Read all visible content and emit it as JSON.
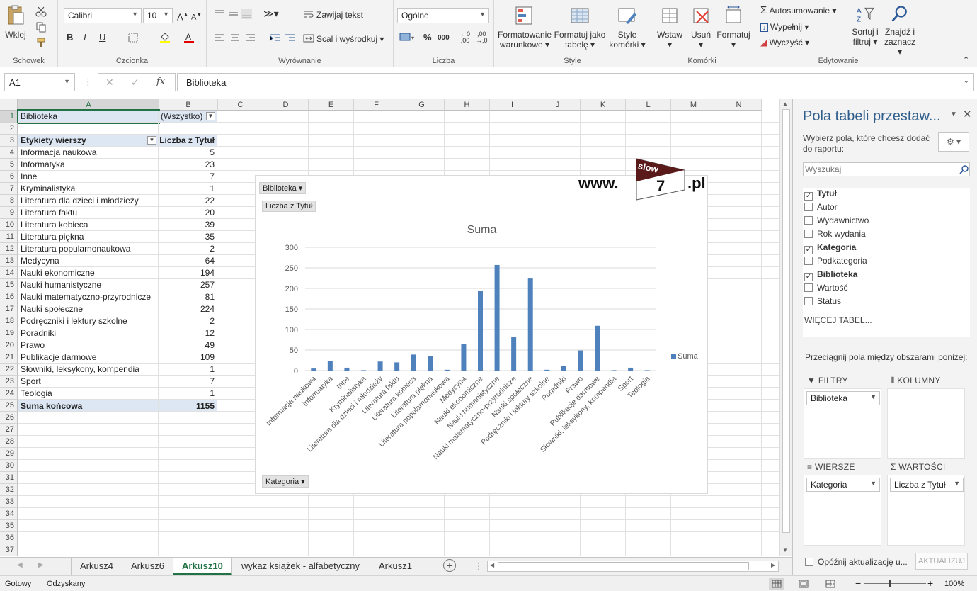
{
  "ribbon": {
    "clipboard": {
      "paste": "Wklej",
      "label": "Schowek"
    },
    "font": {
      "name": "Calibri",
      "size": "10",
      "bold": "B",
      "italic": "I",
      "underline": "U",
      "label": "Czcionka"
    },
    "alignment": {
      "wrap": "Zawijaj tekst",
      "merge": "Scal i wyśrodkuj",
      "label": "Wyrównanie"
    },
    "number": {
      "format": "Ogólne",
      "percent": "%",
      "thousands": "000",
      "label": "Liczba"
    },
    "styles": {
      "conditional": "Formatowanie warunkowe",
      "table": "Formatuj jako tabelę",
      "cell": "Style komórki",
      "label": "Style"
    },
    "cells": {
      "insert": "Wstaw",
      "delete": "Usuń",
      "format": "Formatuj",
      "label": "Komórki"
    },
    "editing": {
      "autosum": "Autosumowanie",
      "fill": "Wypełnij",
      "clear": "Wyczyść",
      "sort": "Sortuj i filtruj",
      "find": "Znajdź i zaznacz",
      "label": "Edytowanie"
    }
  },
  "formula_bar": {
    "cell_ref": "A1",
    "fx": "fx",
    "value": "Biblioteka"
  },
  "columns": [
    "A",
    "B",
    "C",
    "D",
    "E",
    "F",
    "G",
    "H",
    "I",
    "J",
    "K",
    "L",
    "M",
    "N"
  ],
  "pivot": {
    "filter_label": "Biblioteka",
    "filter_value": "(Wszystko)",
    "row_header": "Etykiety wierszy",
    "value_header": "Liczba z Tytuł",
    "rows": [
      {
        "label": "Informacja naukowa",
        "value": "5"
      },
      {
        "label": "Informatyka",
        "value": "23"
      },
      {
        "label": "Inne",
        "value": "7"
      },
      {
        "label": "Kryminalistyka",
        "value": "1"
      },
      {
        "label": "Literatura dla dzieci i młodzieży",
        "value": "22"
      },
      {
        "label": "Literatura faktu",
        "value": "20"
      },
      {
        "label": "Literatura kobieca",
        "value": "39"
      },
      {
        "label": "Literatura piękna",
        "value": "35"
      },
      {
        "label": "Literatura popularnonaukowa",
        "value": "2"
      },
      {
        "label": "Medycyna",
        "value": "64"
      },
      {
        "label": "Nauki ekonomiczne",
        "value": "194"
      },
      {
        "label": "Nauki humanistyczne",
        "value": "257"
      },
      {
        "label": "Nauki matematyczno-przyrodnicze",
        "value": "81"
      },
      {
        "label": "Nauki społeczne",
        "value": "224"
      },
      {
        "label": "Podręczniki i lektury szkolne",
        "value": "2"
      },
      {
        "label": "Poradniki",
        "value": "12"
      },
      {
        "label": "Prawo",
        "value": "49"
      },
      {
        "label": "Publikacje darmowe",
        "value": "109"
      },
      {
        "label": "Słowniki, leksykony, kompendia",
        "value": "1"
      },
      {
        "label": "Sport",
        "value": "7"
      },
      {
        "label": "Teologia",
        "value": "1"
      }
    ],
    "total_label": "Suma końcowa",
    "total_value": "1155"
  },
  "chart_data": {
    "type": "bar",
    "title": "Suma",
    "categories": [
      "Informacja naukowa",
      "Informatyka",
      "Inne",
      "Kryminalistyka",
      "Literatura dla dzieci i młodzieży",
      "Literatura faktu",
      "Literatura kobieca",
      "Literatura piękna",
      "Literatura popularnonaukowa",
      "Medycyna",
      "Nauki ekonomiczne",
      "Nauki humanistyczne",
      "Nauki matematyczno-przyrodnicze",
      "Nauki społeczne",
      "Podręczniki i lektury szkolne",
      "Poradniki",
      "Prawo",
      "Publikacje darmowe",
      "Słowniki, leksykony, kompendia",
      "Sport",
      "Teologia"
    ],
    "series": [
      {
        "name": "Suma",
        "values": [
          5,
          23,
          7,
          1,
          22,
          20,
          39,
          35,
          2,
          64,
          194,
          257,
          81,
          224,
          2,
          12,
          49,
          109,
          1,
          7,
          1
        ]
      }
    ],
    "ylim": [
      0,
      300
    ],
    "yticks": [
      0,
      50,
      100,
      150,
      200,
      250,
      300
    ],
    "legend": "right",
    "color": "#4f81bd",
    "filter_button": "Biblioteka",
    "value_button": "Liczba z Tytuł",
    "axis_button": "Kategoria"
  },
  "watermark": {
    "prefix": "www.",
    "brand": "slow",
    "num": "7",
    "suffix": ".pl"
  },
  "sheet_tabs": [
    "Arkusz4",
    "Arkusz6",
    "Arkusz10",
    "wykaz książek - alfabetyczny",
    "Arkusz1"
  ],
  "active_tab": "Arkusz10",
  "status": {
    "ready": "Gotowy",
    "recovered": "Odzyskany",
    "zoom": "100%"
  },
  "pane": {
    "title": "Pola tabeli przestaw...",
    "subtitle": "Wybierz pola, które chcesz dodać do raportu:",
    "search_placeholder": "Wyszukaj",
    "fields": [
      {
        "name": "Tytuł",
        "checked": true
      },
      {
        "name": "Autor",
        "checked": false
      },
      {
        "name": "Wydawnictwo",
        "checked": false
      },
      {
        "name": "Rok wydania",
        "checked": false
      },
      {
        "name": "Kategoria",
        "checked": true
      },
      {
        "name": "Podkategoria",
        "checked": false
      },
      {
        "name": "Biblioteka",
        "checked": true
      },
      {
        "name": "Wartość",
        "checked": false
      },
      {
        "name": "Status",
        "checked": false
      }
    ],
    "more_tables": "WIĘCEJ TABEL...",
    "drag_hint": "Przeciągnij pola między obszarami poniżej:",
    "filters_label": "FILTRY",
    "columns_label": "KOLUMNY",
    "rows_label": "WIERSZE",
    "values_label": "WARTOŚCI",
    "filters_item": "Biblioteka",
    "rows_item": "Kategoria",
    "values_item": "Liczba z Tytuł",
    "defer_label": "Opóźnij aktualizację u...",
    "update_button": "AKTUALIZUJ"
  }
}
